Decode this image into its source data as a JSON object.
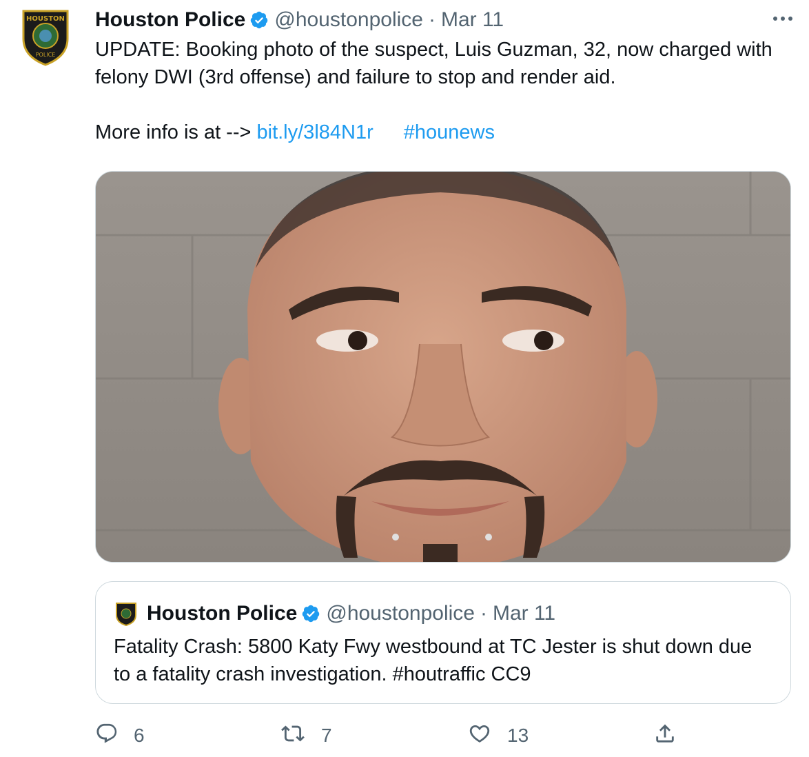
{
  "tweet": {
    "author_name": "Houston Police",
    "handle": "@houstonpolice",
    "separator": "·",
    "date": "Mar 11",
    "text_line1": "UPDATE: Booking photo of the suspect, Luis Guzman, 32, now charged with felony DWI (3rd offense) and failure to stop and render aid.",
    "text_more_prefix": "More info is at -->",
    "link": "bit.ly/3l84N1r",
    "hashtag": "#hounews",
    "avatar_logo_text_top": "HOUSTON",
    "avatar_logo_text_bottom": "POLICE"
  },
  "quoted_tweet": {
    "author_name": "Houston Police",
    "handle": "@houstonpolice",
    "separator": "·",
    "date": "Mar 11",
    "text": "Fatality Crash: 5800 Katy Fwy westbound at TC Jester is shut down due to a fatality crash investigation. #houtraffic CC9"
  },
  "actions": {
    "reply_count": "6",
    "retweet_count": "7",
    "like_count": "13"
  },
  "icons": {
    "verified": "verified-badge-icon",
    "more": "more-options-icon",
    "reply": "reply-icon",
    "retweet": "retweet-icon",
    "like": "heart-icon",
    "share": "share-icon"
  },
  "colors": {
    "link": "#1d9bf0",
    "text": "#0f1419",
    "secondary": "#536471",
    "border": "#cfd9de",
    "badge_gold": "#c9a227"
  }
}
